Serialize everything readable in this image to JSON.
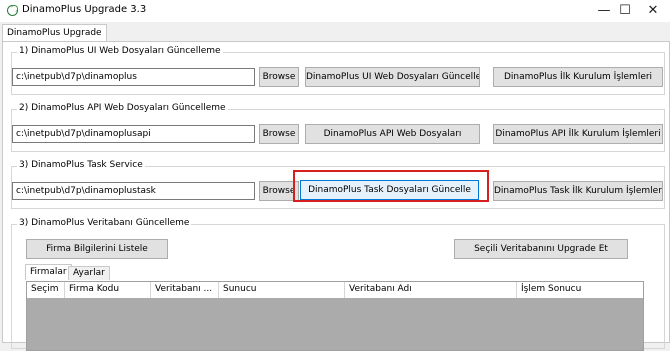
{
  "window": {
    "title": "DinamoPlus Upgrade 3.3",
    "minimize": "—",
    "maximize": "☐",
    "close": "✕"
  },
  "tabs": [
    {
      "label": "DinamoPlus Upgrade"
    }
  ],
  "sections": [
    {
      "legend": "1) DinamoPlus UI Web Dosyaları Güncelleme",
      "path": "c:\\inetpub\\d7p\\dinamoplus",
      "browse": "Browse",
      "update": "DinamoPlus UI Web Dosyaları Güncelle",
      "setup": "DinamoPlus İlk Kurulum İşlemleri"
    },
    {
      "legend": "2) DinamoPlus API Web Dosyaları Güncelleme",
      "path": "c:\\inetpub\\d7p\\dinamoplusapi",
      "browse": "Browse",
      "update": "DinamoPlus API Web Dosyaları",
      "setup": "DinamoPlus API İlk Kurulum İşlemleri"
    },
    {
      "legend": "3) DinamoPlus Task Service",
      "path": "c:\\inetpub\\d7p\\dinamoplustask",
      "browse": "Browse",
      "update": "DinamoPlus Task Dosyaları Güncelle",
      "setup": "DinamoPlus Task İlk Kurulum İşlemleri"
    }
  ],
  "db_section": {
    "legend": "3) DinamoPlus Veritabanı Güncelleme",
    "list_button": "Firma Bilgilerini Listele",
    "upgrade_button": "Seçili Veritabanını Upgrade Et",
    "tabs": [
      {
        "label": "Firmalar"
      },
      {
        "label": "Ayarlar"
      }
    ],
    "columns": [
      "Seçim",
      "Firma Kodu",
      "Veritabanı ...",
      "Sunucu",
      "Veritabanı Adı",
      "İşlem Sonucu"
    ]
  },
  "colors": {
    "highlight": "#d61f1f",
    "active_button_border": "#0078d7"
  }
}
